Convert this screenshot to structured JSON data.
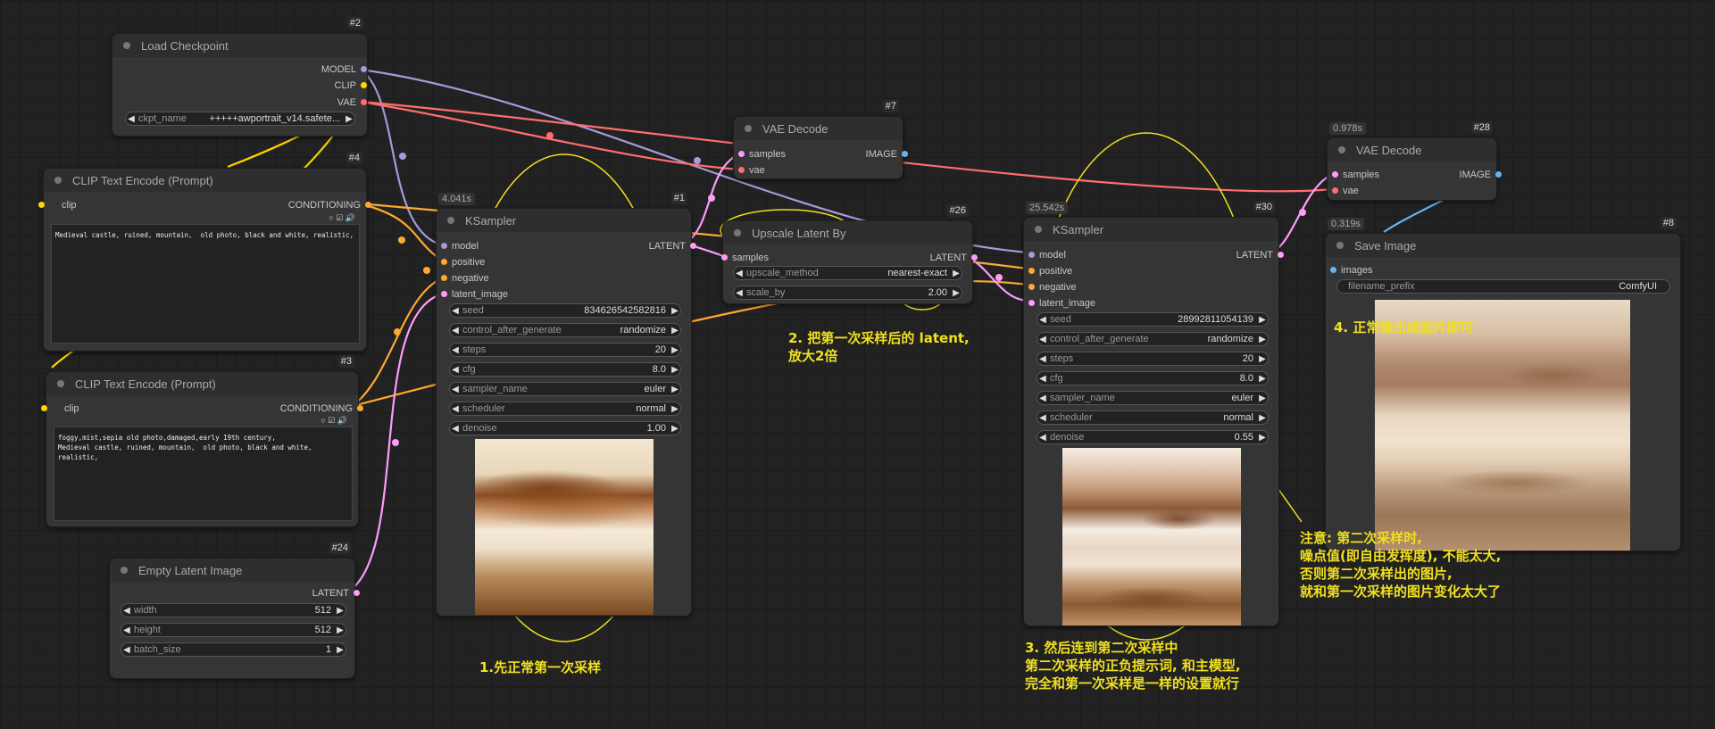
{
  "colors": {
    "model": "#a899d9",
    "clip": "#ffd500",
    "vae": "#ff6e6e",
    "conditioning": "#ffa931",
    "latent": "#ff9cf9",
    "image": "#64b5f6",
    "annotation": "#f0e020"
  },
  "nodes": {
    "load_checkpoint": {
      "id": "#2",
      "title": "Load Checkpoint",
      "outputs": [
        "MODEL",
        "CLIP",
        "VAE"
      ],
      "widgets": [
        {
          "label": "ckpt_name",
          "value": "+++++awportrait_v14.safete..."
        }
      ]
    },
    "clip_pos": {
      "id": "#4",
      "title": "CLIP Text Encode (Prompt)",
      "input": "clip",
      "output": "CONDITIONING",
      "text": "Medieval castle, ruined, mountain,  old photo, black and white, realistic,"
    },
    "clip_neg": {
      "id": "#3",
      "title": "CLIP Text Encode (Prompt)",
      "input": "clip",
      "output": "CONDITIONING",
      "text": "foggy,mist,sepia old photo,damaged,early 19th century,\nMedieval castle, ruined, mountain,  old photo, black and white,\nrealistic,"
    },
    "empty_latent": {
      "id": "#24",
      "title": "Empty Latent Image",
      "output": "LATENT",
      "widgets": [
        {
          "label": "width",
          "value": "512"
        },
        {
          "label": "height",
          "value": "512"
        },
        {
          "label": "batch_size",
          "value": "1"
        }
      ]
    },
    "ksampler1": {
      "id": "#1",
      "timing": "4.041s",
      "title": "KSampler",
      "inputs": [
        "model",
        "positive",
        "negative",
        "latent_image"
      ],
      "output": "LATENT",
      "widgets": [
        {
          "label": "seed",
          "value": "834626542582816"
        },
        {
          "label": "control_after_generate",
          "value": "randomize"
        },
        {
          "label": "steps",
          "value": "20"
        },
        {
          "label": "cfg",
          "value": "8.0"
        },
        {
          "label": "sampler_name",
          "value": "euler"
        },
        {
          "label": "scheduler",
          "value": "normal"
        },
        {
          "label": "denoise",
          "value": "1.00"
        }
      ]
    },
    "vae_decode1": {
      "id": "#7",
      "title": "VAE Decode",
      "inputs": [
        "samples",
        "vae"
      ],
      "output": "IMAGE"
    },
    "upscale": {
      "id": "#26",
      "title": "Upscale Latent By",
      "input": "samples",
      "output": "LATENT",
      "widgets": [
        {
          "label": "upscale_method",
          "value": "nearest-exact"
        },
        {
          "label": "scale_by",
          "value": "2.00"
        }
      ]
    },
    "ksampler2": {
      "id": "#30",
      "timing": "25.542s",
      "title": "KSampler",
      "inputs": [
        "model",
        "positive",
        "negative",
        "latent_image"
      ],
      "output": "LATENT",
      "widgets": [
        {
          "label": "seed",
          "value": "28992811054139"
        },
        {
          "label": "control_after_generate",
          "value": "randomize"
        },
        {
          "label": "steps",
          "value": "20"
        },
        {
          "label": "cfg",
          "value": "8.0"
        },
        {
          "label": "sampler_name",
          "value": "euler"
        },
        {
          "label": "scheduler",
          "value": "normal"
        },
        {
          "label": "denoise",
          "value": "0.55"
        }
      ]
    },
    "vae_decode2": {
      "id": "#28",
      "timing": "0.978s",
      "title": "VAE Decode",
      "inputs": [
        "samples",
        "vae"
      ],
      "output": "IMAGE"
    },
    "save_image": {
      "id": "#8",
      "timing": "0.319s",
      "title": "Save Image",
      "input": "images",
      "widgets": [
        {
          "label": "filename_prefix",
          "value": "ComfyUI"
        }
      ]
    }
  },
  "annotations": {
    "step1": "1.先正常第一次采样",
    "step2": "2. 把第一次采样后的 latent,\n放大2倍",
    "step3": "3. 然后连到第二次采样中\n第二次采样的正负提示词, 和主模型,\n完全和第一次采样是一样的设置就行",
    "step4": "4. 正常输出成图片即可",
    "note": "注意: 第二次采样时,\n噪点值(即自由发挥度), 不能太大,\n否则第二次采样出的图片,\n就和第一次采样的图片变化太大了"
  }
}
